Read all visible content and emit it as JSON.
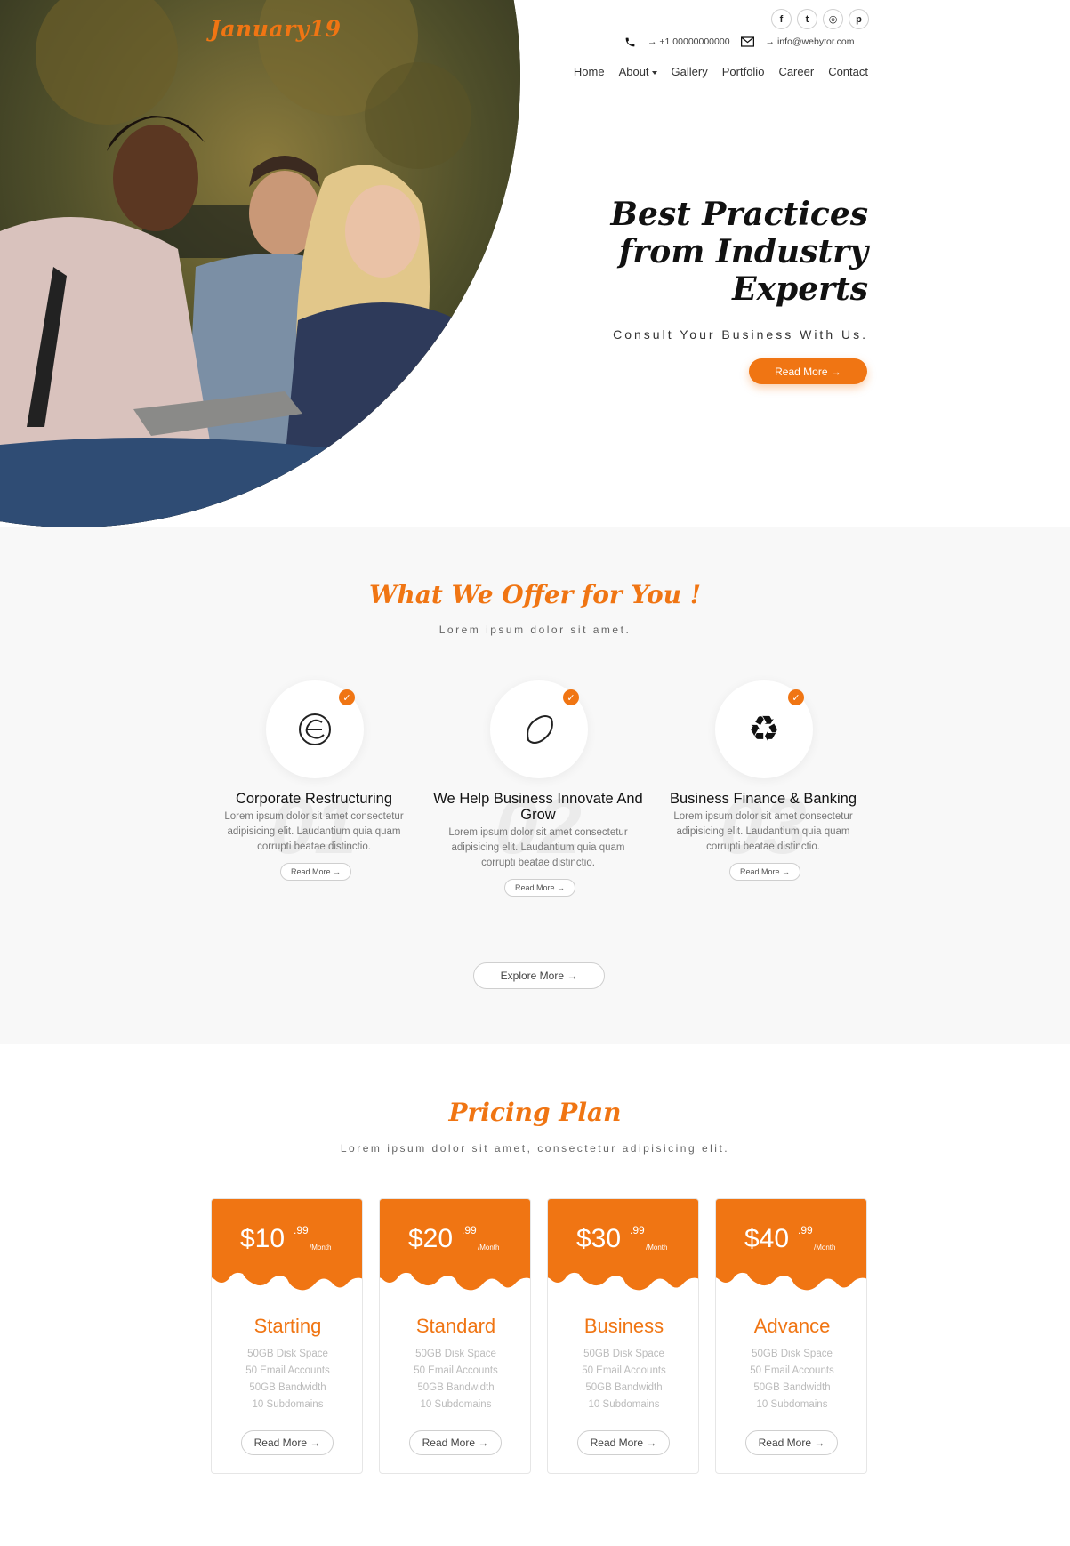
{
  "brand": {
    "logo": "January19",
    "accent": "#f07513"
  },
  "social": [
    {
      "icon": "facebook-icon",
      "glyph": "f"
    },
    {
      "icon": "twitter-icon",
      "glyph": "t"
    },
    {
      "icon": "instagram-icon",
      "glyph": "◎"
    },
    {
      "icon": "pinterest-icon",
      "glyph": "p"
    }
  ],
  "contact": {
    "phone": "→ +1 00000000000",
    "email": "→ info@webytor.com"
  },
  "nav": [
    "Home",
    "About",
    "Gallery",
    "Portfolio",
    "Career",
    "Contact"
  ],
  "hero": {
    "title_line1": "Best Practices",
    "title_line2": "from Industry",
    "title_line3": "Experts",
    "subtitle": "Consult Your Business With Us.",
    "button": "Read More →"
  },
  "offer": {
    "title": "What We Offer for You !",
    "subtitle": "Lorem ipsum dolor sit amet.",
    "features": [
      {
        "number": "01",
        "title": "Corporate Restructuring",
        "desc": "Lorem ipsum dolor sit amet consectetur adipisicing elit. Laudantium quia quam corrupti beatae distinctio.",
        "button": "Read More  →",
        "icon": "globe-icon"
      },
      {
        "number": "02",
        "title": "We Help Business Innovate And Grow",
        "desc": "Lorem ipsum dolor sit amet consectetur adipisicing elit. Laudantium quia quam corrupti beatae distinctio.",
        "button": "Read More  →",
        "icon": "lemon-icon"
      },
      {
        "number": "03",
        "title": "Business Finance & Banking",
        "desc": "Lorem ipsum dolor sit amet consectetur adipisicing elit. Laudantium quia quam corrupti beatae distinctio.",
        "button": "Read More  →",
        "icon": "recycle-icon"
      }
    ],
    "explore": "Explore More  →"
  },
  "pricing": {
    "title": "Pricing Plan",
    "subtitle": "Lorem ipsum dolor sit amet, consectetur adipisicing elit.",
    "plans": [
      {
        "price": "$10",
        "cents": ".99",
        "period": "/Month",
        "name": "Starting",
        "features": [
          "50GB Disk Space",
          "50 Email Accounts",
          "50GB Bandwidth",
          "10 Subdomains"
        ],
        "button": "Read More  →"
      },
      {
        "price": "$20",
        "cents": ".99",
        "period": "/Month",
        "name": "Standard",
        "features": [
          "50GB Disk Space",
          "50 Email Accounts",
          "50GB Bandwidth",
          "10 Subdomains"
        ],
        "button": "Read More  →"
      },
      {
        "price": "$30",
        "cents": ".99",
        "period": "/Month",
        "name": "Business",
        "features": [
          "50GB Disk Space",
          "50 Email Accounts",
          "50GB Bandwidth",
          "10 Subdomains"
        ],
        "button": "Read More  →"
      },
      {
        "price": "$40",
        "cents": ".99",
        "period": "/Month",
        "name": "Advance",
        "features": [
          "50GB Disk Space",
          "50 Email Accounts",
          "50GB Bandwidth",
          "10 Subdomains"
        ],
        "button": "Read More  →"
      }
    ]
  }
}
